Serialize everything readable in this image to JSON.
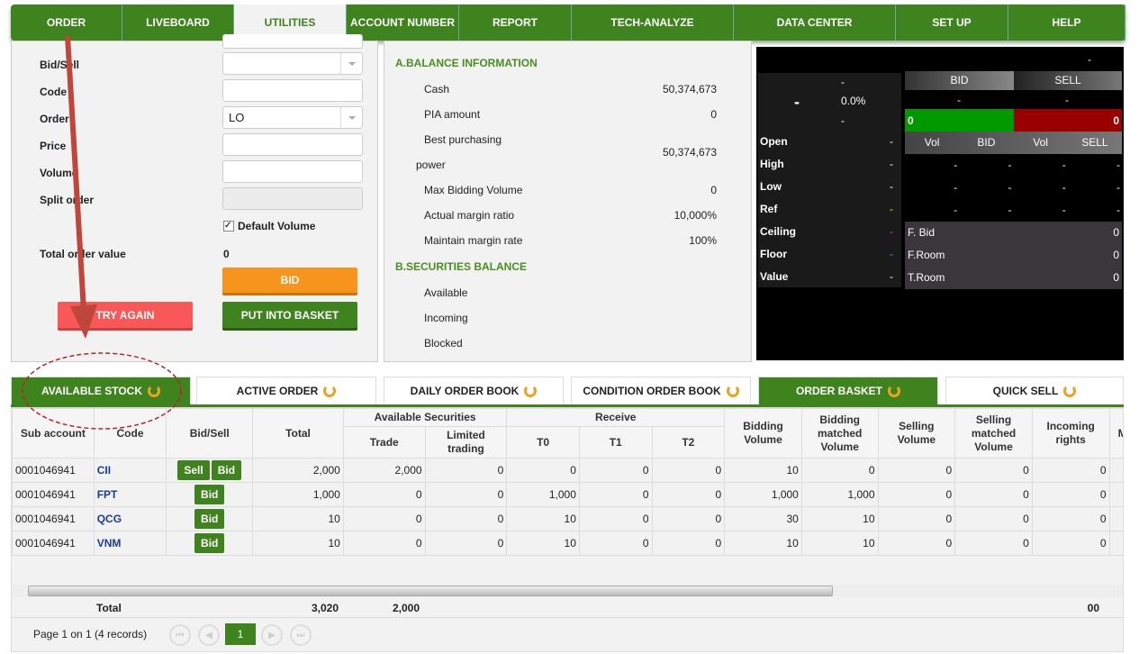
{
  "nav": {
    "tabs": [
      "ORDER",
      "LIVEBOARD",
      "UTILITIES",
      "ACCOUNT NUMBER",
      "REPORT",
      "TECH-ANALYZE",
      "DATA CENTER",
      "SET UP",
      "HELP"
    ],
    "active": "UTILITIES"
  },
  "form": {
    "bid_sell_label": "Bid/Sell",
    "code_label": "Code",
    "order_label": "Order",
    "order_value": "LO",
    "price_label": "Price",
    "volume_label": "Volume",
    "split_label": "Split order",
    "default_volume_label": "Default Volume",
    "default_volume_checked": true,
    "total_label": "Total order value",
    "total_value": "0",
    "bid_btn": "BID",
    "try_again_btn": "TRY AGAIN",
    "basket_btn": "PUT INTO BASKET"
  },
  "balance": {
    "a_title": "A.BALANCE INFORMATION",
    "cash_label": "Cash",
    "cash": "50,374,673",
    "pia_label": "PIA amount",
    "pia": "0",
    "bpp_label": "Best purchasing",
    "bpp_label2": "power",
    "bpp": "50,374,673",
    "mbv_label": "Max Bidding Volume",
    "mbv": "0",
    "amr_label": "Actual margin ratio",
    "amr": "10,000%",
    "mmr_label": "Maintain margin rate",
    "mmr": "100%",
    "b_title": "B.SECURITIES BALANCE",
    "available_label": "Available",
    "incoming_label": "Incoming",
    "blocked_label": "Blocked"
  },
  "quote": {
    "top_dash": "-",
    "price": "-",
    "change_top": "-",
    "pct": "0.0%",
    "change_bottom": "-",
    "rows": [
      {
        "label": "Open",
        "value": "-"
      },
      {
        "label": "High",
        "value": "-"
      },
      {
        "label": "Low",
        "value": "-"
      },
      {
        "label": "Ref",
        "value": "-"
      },
      {
        "label": "Ceiling",
        "value": "-"
      },
      {
        "label": "Floor",
        "value": "-"
      },
      {
        "label": "Value",
        "value": "-"
      }
    ],
    "bid_label": "BID",
    "sell_label": "SELL",
    "bid_dash": "-",
    "sell_dash": "-",
    "bid_total": "0",
    "sell_total": "0",
    "depth_headers": [
      "Vol",
      "BID",
      "Vol",
      "SELL"
    ],
    "depth_rows": [
      [
        "-",
        "-",
        "-",
        "-"
      ],
      [
        "-",
        "-",
        "-",
        "-"
      ],
      [
        "-",
        "-",
        "-",
        "-"
      ]
    ],
    "foreign": [
      {
        "label": "F. Bid",
        "value": "0"
      },
      {
        "label": "F.Room",
        "value": "0"
      },
      {
        "label": "T.Room",
        "value": "0"
      }
    ],
    "colors": {
      "ref": "#e0e000",
      "ceiling": "#e020e0",
      "floor": "#20a0f0",
      "bid_bar": "#009900",
      "sell_bar": "#990000"
    }
  },
  "bottom_tabs": [
    "AVAILABLE STOCK",
    "ACTIVE ORDER",
    "DAILY ORDER BOOK",
    "CONDITION ORDER BOOK",
    "ORDER BASKET",
    "QUICK SELL"
  ],
  "table": {
    "headers": {
      "sub": "Sub account",
      "code": "Code",
      "bidsell": "Bid/Sell",
      "total": "Total",
      "avail": "Available Securities",
      "trade": "Trade",
      "limited": "Limited trading",
      "receive": "Receive",
      "t0": "T0",
      "t1": "T1",
      "t2": "T2",
      "bidvol": "Bidding Volume",
      "bidmatched": "Bidding matched Volume",
      "sellvol": "Selling Volume",
      "sellmatched": "Selling matched Volume",
      "incoming": "Incoming rights",
      "next": "M V"
    },
    "rows": [
      {
        "sub": "0001046941",
        "code": "CII",
        "actions": [
          "Sell",
          "Bid"
        ],
        "vals": [
          "2,000",
          "2,000",
          "0",
          "0",
          "0",
          "0",
          "10",
          "0",
          "0",
          "0",
          "0"
        ]
      },
      {
        "sub": "0001046941",
        "code": "FPT",
        "actions": [
          "Bid"
        ],
        "vals": [
          "1,000",
          "0",
          "0",
          "1,000",
          "0",
          "0",
          "1,000",
          "1,000",
          "0",
          "0",
          "0"
        ]
      },
      {
        "sub": "0001046941",
        "code": "QCG",
        "actions": [
          "Bid"
        ],
        "vals": [
          "10",
          "0",
          "0",
          "10",
          "0",
          "0",
          "30",
          "10",
          "0",
          "0",
          "0"
        ]
      },
      {
        "sub": "0001046941",
        "code": "VNM",
        "actions": [
          "Bid"
        ],
        "vals": [
          "10",
          "0",
          "0",
          "10",
          "0",
          "0",
          "10",
          "10",
          "0",
          "0",
          "0"
        ]
      }
    ],
    "total_label": "Total",
    "total_total": "3,020",
    "total_trade": "2,000",
    "total_last": "00"
  },
  "pager": {
    "text": "Page 1 on 1 (4 records)",
    "current": "1"
  }
}
